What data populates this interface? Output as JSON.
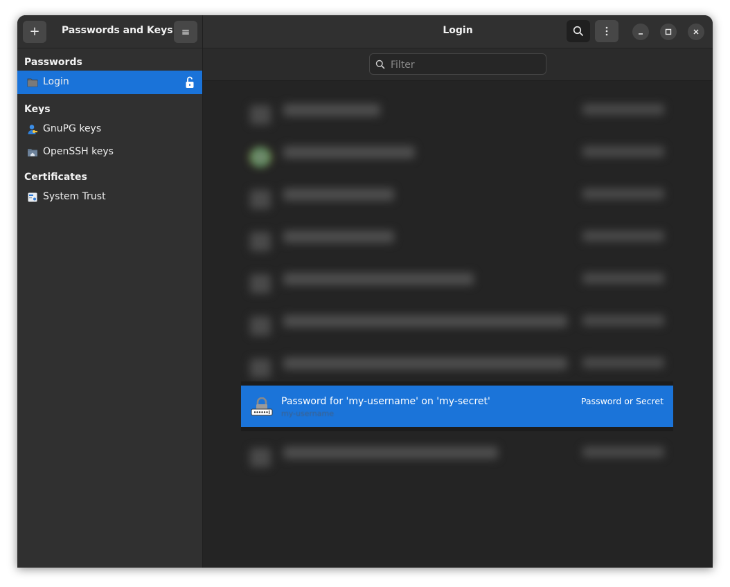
{
  "app": {
    "title": "Passwords and Keys",
    "add_button": "+",
    "menu_button": "≡"
  },
  "sidebar": {
    "sections": [
      {
        "label": "Passwords",
        "items": [
          {
            "label": "Login",
            "selected": true,
            "icon": "folder-icon",
            "locked": false
          }
        ]
      },
      {
        "label": "Keys",
        "items": [
          {
            "label": "GnuPG keys",
            "icon": "person-key-icon"
          },
          {
            "label": "OpenSSH keys",
            "icon": "ssh-home-folder-icon"
          }
        ]
      },
      {
        "label": "Certificates",
        "items": [
          {
            "label": "System Trust",
            "icon": "certificate-icon"
          }
        ]
      }
    ]
  },
  "header": {
    "title": "Login"
  },
  "filter": {
    "placeholder": "Filter",
    "value": ""
  },
  "selected_item": {
    "title": "Password for 'my-username' on 'my-secret'",
    "subtitle": "my-username",
    "type": "Password or Secret"
  },
  "colors": {
    "accent": "#1b74d9",
    "window_bg": "#242424",
    "sidebar_bg": "#303030"
  }
}
